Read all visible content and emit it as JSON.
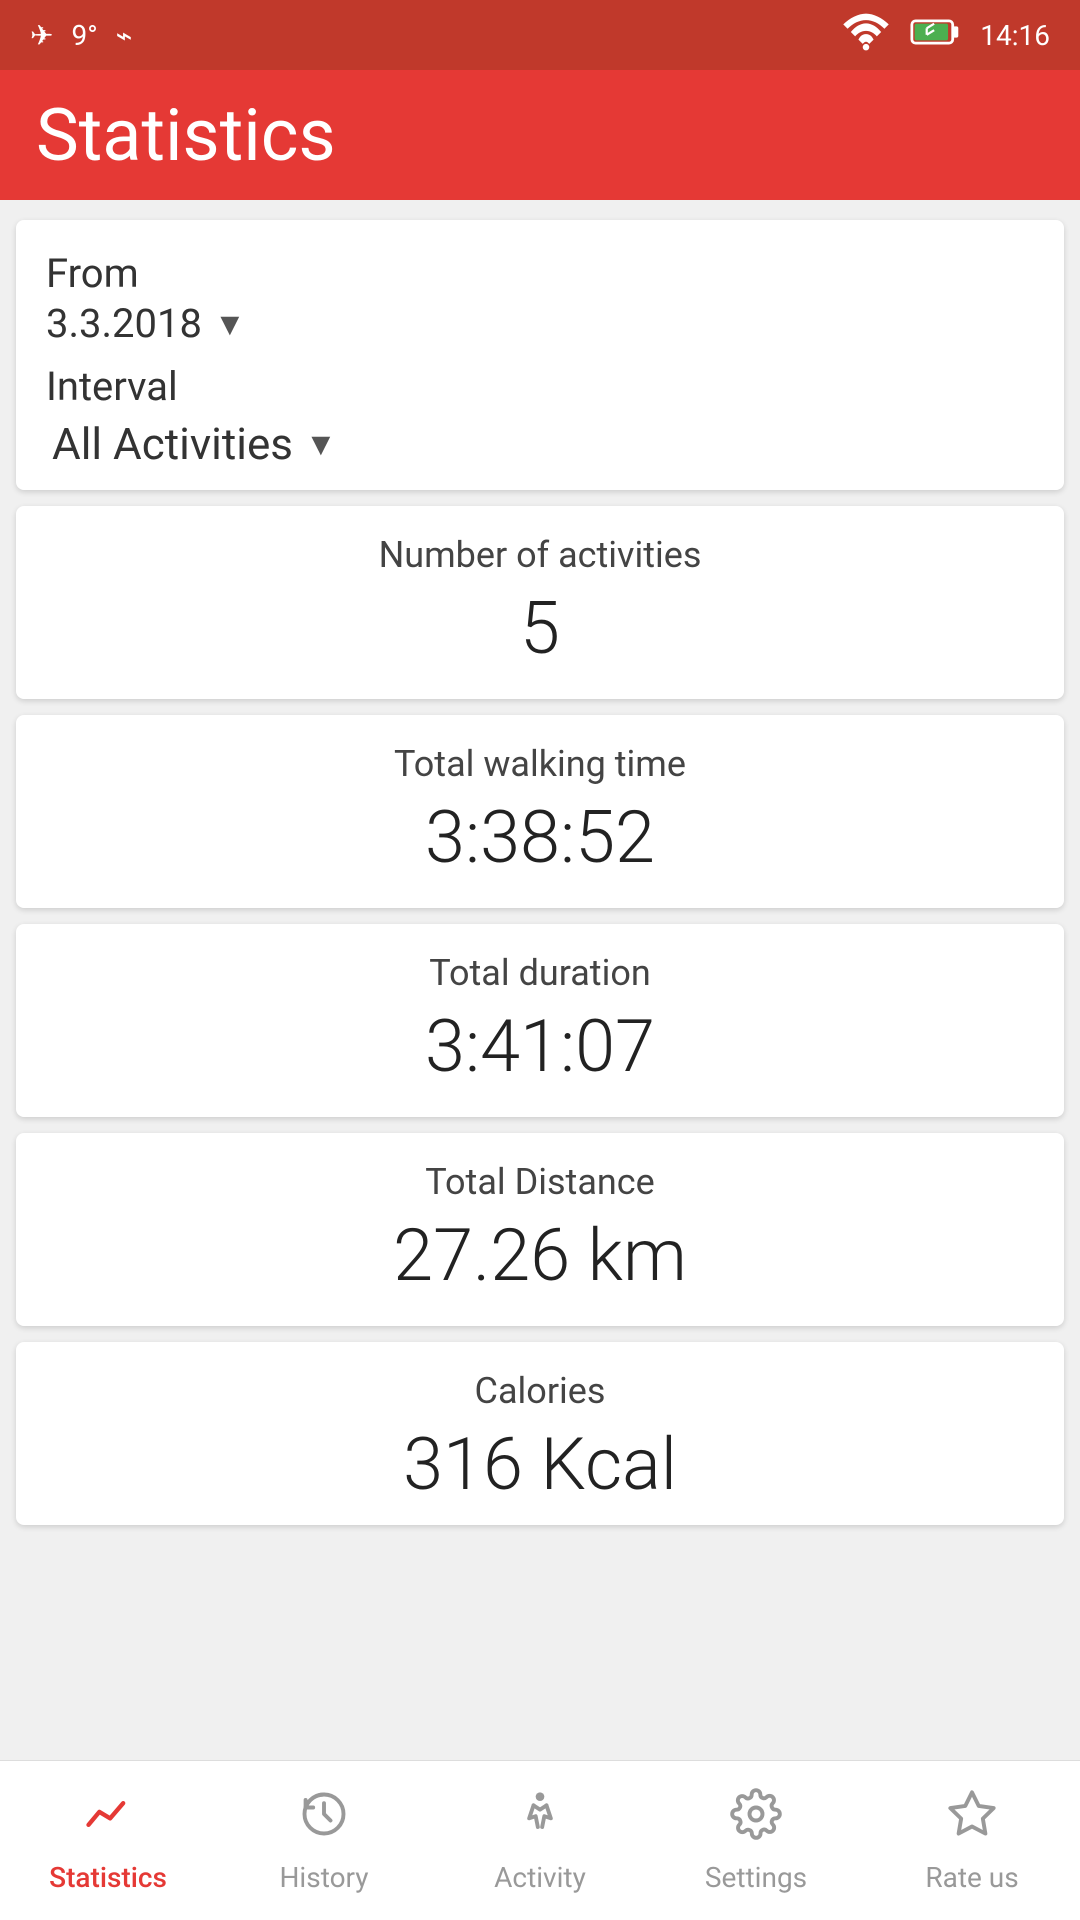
{
  "status_bar": {
    "left_icons": [
      "airplane",
      "9°",
      "usb"
    ],
    "right_icons": [
      "wifi",
      "battery"
    ],
    "time": "14:16"
  },
  "header": {
    "title": "Statistics"
  },
  "filter_card": {
    "from_label": "From",
    "date": "3.3.2018",
    "interval_label": "Interval",
    "activities_label": "All Activities"
  },
  "stats": [
    {
      "label": "Number of activities",
      "value": "5"
    },
    {
      "label": "Total walking time",
      "value": "3:38:52"
    },
    {
      "label": "Total duration",
      "value": "3:41:07"
    },
    {
      "label": "Total Distance",
      "value": "27.26 km"
    }
  ],
  "calories_card": {
    "label": "Calories",
    "value_partial": "316 Kcal"
  },
  "bottom_nav": [
    {
      "id": "statistics",
      "label": "Statistics",
      "active": true
    },
    {
      "id": "history",
      "label": "History",
      "active": false
    },
    {
      "id": "activity",
      "label": "Activity",
      "active": false
    },
    {
      "id": "settings",
      "label": "Settings",
      "active": false
    },
    {
      "id": "rate-us",
      "label": "Rate us",
      "active": false
    }
  ]
}
